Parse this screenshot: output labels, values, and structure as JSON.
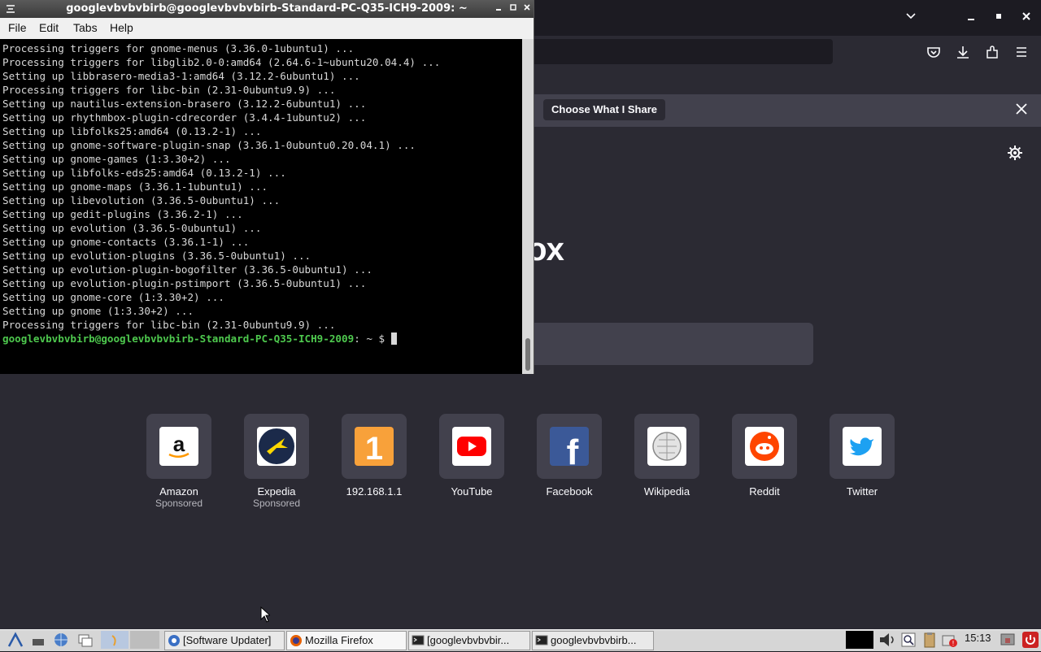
{
  "terminal": {
    "title": "googlevbvbvbirb@googlevbvbvbirb-Standard-PC-Q35-ICH9-2009: ~",
    "menu": [
      "File",
      "Edit",
      "Tabs",
      "Help"
    ],
    "lines": [
      "Processing triggers for gnome-menus (3.36.0-1ubuntu1) ...",
      "Processing triggers for libglib2.0-0:amd64 (2.64.6-1~ubuntu20.04.4) ...",
      "Setting up libbrasero-media3-1:amd64 (3.12.2-6ubuntu1) ...",
      "Processing triggers for libc-bin (2.31-0ubuntu9.9) ...",
      "Setting up nautilus-extension-brasero (3.12.2-6ubuntu1) ...",
      "Setting up rhythmbox-plugin-cdrecorder (3.4.4-1ubuntu2) ...",
      "Setting up libfolks25:amd64 (0.13.2-1) ...",
      "Setting up gnome-software-plugin-snap (3.36.1-0ubuntu0.20.04.1) ...",
      "Setting up gnome-games (1:3.30+2) ...",
      "Setting up libfolks-eds25:amd64 (0.13.2-1) ...",
      "Setting up gnome-maps (3.36.1-1ubuntu1) ...",
      "Setting up libevolution (3.36.5-0ubuntu1) ...",
      "Setting up gedit-plugins (3.36.2-1) ...",
      "Setting up evolution (3.36.5-0ubuntu1) ...",
      "Setting up gnome-contacts (3.36.1-1) ...",
      "Setting up evolution-plugins (3.36.5-0ubuntu1) ...",
      "Setting up evolution-plugin-bogofilter (3.36.5-0ubuntu1) ...",
      "Setting up evolution-plugin-pstimport (3.36.5-0ubuntu1) ...",
      "Setting up gnome-core (1:3.30+2) ...",
      "Setting up gnome (1:3.30+2) ...",
      "Processing triggers for libc-bin (2.31-0ubuntu9.9) ..."
    ],
    "prompt_user": "googlevbvbvbirb@googlevbvbvbirb-Standard-PC-Q35-ICH9-2009",
    "prompt_suffix": ": ~ $"
  },
  "firefox": {
    "notification_button": "Choose What I Share",
    "brand_partial": "refox",
    "tiles": [
      {
        "label": "Amazon",
        "sub": "Sponsored",
        "icon": "amazon-icon"
      },
      {
        "label": "Expedia",
        "sub": "Sponsored",
        "icon": "expedia-icon"
      },
      {
        "label": "192.168.1.1",
        "sub": "",
        "icon": "router-icon"
      },
      {
        "label": "YouTube",
        "sub": "",
        "icon": "youtube-icon"
      },
      {
        "label": "Facebook",
        "sub": "",
        "icon": "facebook-icon"
      },
      {
        "label": "Wikipedia",
        "sub": "",
        "icon": "wikipedia-icon"
      },
      {
        "label": "Reddit",
        "sub": "",
        "icon": "reddit-icon"
      },
      {
        "label": "Twitter",
        "sub": "",
        "icon": "twitter-icon"
      }
    ]
  },
  "taskbar": {
    "tasks": [
      {
        "label": "[Software Updater]",
        "icon": "updater-icon"
      },
      {
        "label": "Mozilla Firefox",
        "icon": "firefox-icon"
      },
      {
        "label": "[googlevbvbvbir...",
        "icon": "terminal-icon"
      },
      {
        "label": "googlevbvbvbirb...",
        "icon": "terminal-icon"
      }
    ],
    "clock": "15:13"
  },
  "colors": {
    "firefox_bg": "#2b2a33",
    "terminal_bg": "#000000",
    "prompt_green": "#4ec94e",
    "taskbar_bg": "#d6d6d6"
  }
}
